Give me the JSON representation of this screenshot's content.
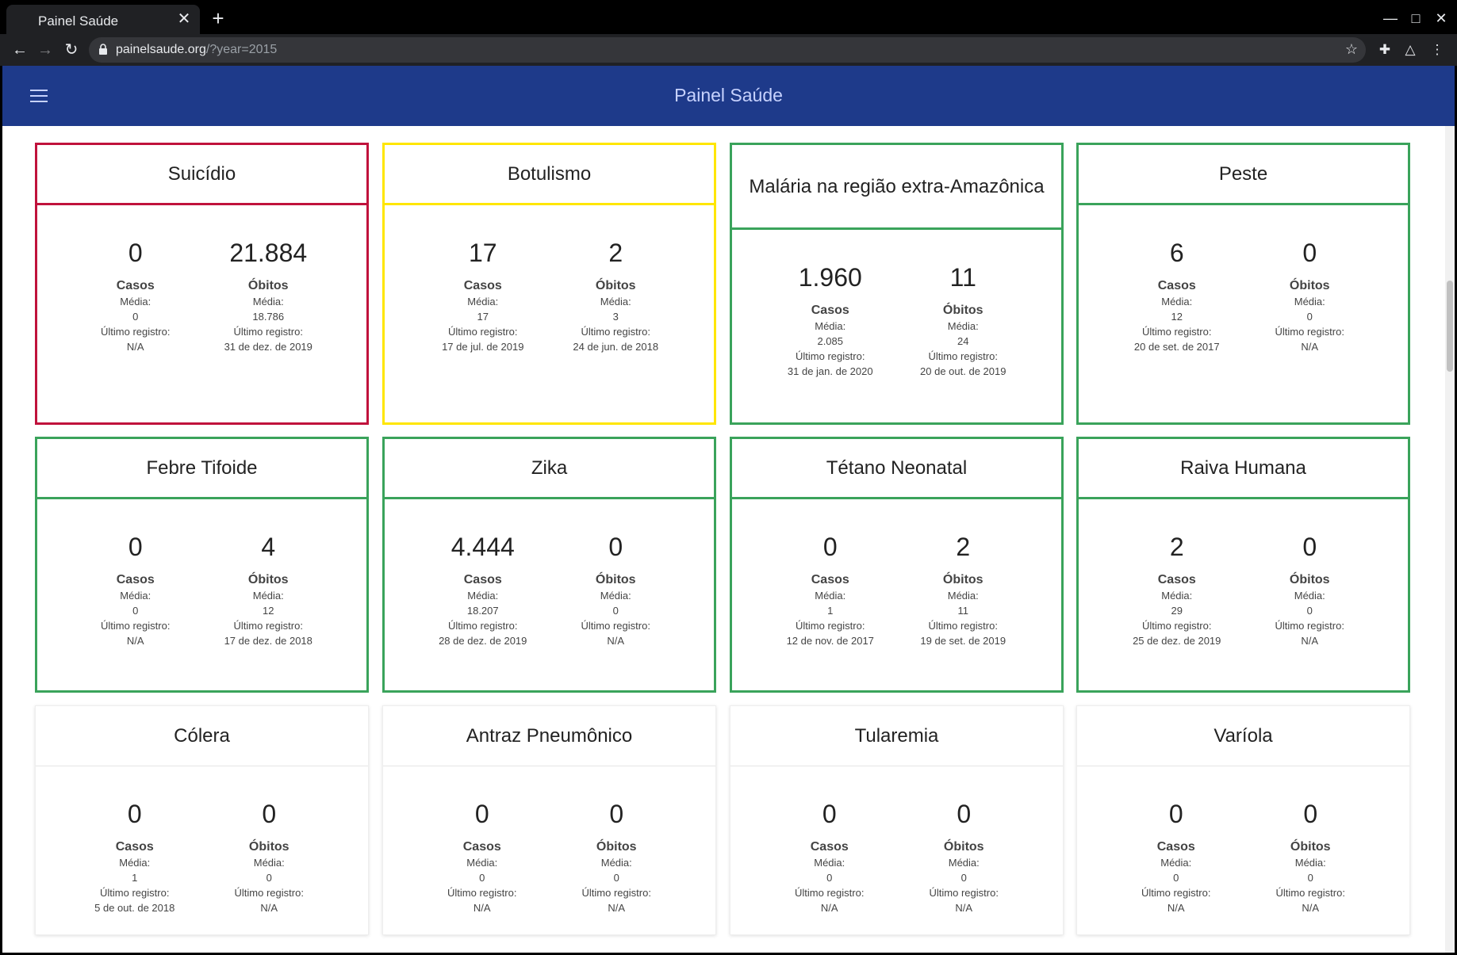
{
  "browser": {
    "tab_title": "Painel Saúde",
    "url_host": "painelsaude.org",
    "url_path": "/?year=2015"
  },
  "app": {
    "title": "Painel Saúde"
  },
  "cards": [
    {
      "title": "Suicídio",
      "status": "red",
      "casos": "0",
      "obitos": "21.884",
      "casos_media": "0",
      "obitos_media": "18.786",
      "casos_ultimo": "N/A",
      "obitos_ultimo": "31 de dez. de 2019"
    },
    {
      "title": "Botulismo",
      "status": "yellow",
      "casos": "17",
      "obitos": "2",
      "casos_media": "17",
      "obitos_media": "3",
      "casos_ultimo": "17 de jul. de 2019",
      "obitos_ultimo": "24 de jun. de 2018"
    },
    {
      "title": "Malária na região extra-Amazônica",
      "status": "green",
      "casos": "1.960",
      "obitos": "11",
      "casos_media": "2.085",
      "obitos_media": "24",
      "casos_ultimo": "31 de jan. de 2020",
      "obitos_ultimo": "20 de out. de 2019"
    },
    {
      "title": "Peste",
      "status": "green",
      "casos": "6",
      "obitos": "0",
      "casos_media": "12",
      "obitos_media": "0",
      "casos_ultimo": "20 de set. de 2017",
      "obitos_ultimo": "N/A"
    },
    {
      "title": "Febre Tifoide",
      "status": "green",
      "casos": "0",
      "obitos": "4",
      "casos_media": "0",
      "obitos_media": "12",
      "casos_ultimo": "N/A",
      "obitos_ultimo": "17 de dez. de 2018"
    },
    {
      "title": "Zika",
      "status": "green",
      "casos": "4.444",
      "obitos": "0",
      "casos_media": "18.207",
      "obitos_media": "0",
      "casos_ultimo": "28 de dez. de 2019",
      "obitos_ultimo": "N/A"
    },
    {
      "title": "Tétano Neonatal",
      "status": "green",
      "casos": "0",
      "obitos": "2",
      "casos_media": "1",
      "obitos_media": "11",
      "casos_ultimo": "12 de nov. de 2017",
      "obitos_ultimo": "19 de set. de 2019"
    },
    {
      "title": "Raiva Humana",
      "status": "green",
      "casos": "2",
      "obitos": "0",
      "casos_media": "29",
      "obitos_media": "0",
      "casos_ultimo": "25 de dez. de 2019",
      "obitos_ultimo": "N/A"
    },
    {
      "title": "Cólera",
      "status": "plain",
      "casos": "0",
      "obitos": "0",
      "casos_media": "1",
      "obitos_media": "0",
      "casos_ultimo": "5 de out. de 2018",
      "obitos_ultimo": "N/A"
    },
    {
      "title": "Antraz Pneumônico",
      "status": "plain",
      "casos": "0",
      "obitos": "0",
      "casos_media": "0",
      "obitos_media": "0",
      "casos_ultimo": "N/A",
      "obitos_ultimo": "N/A"
    },
    {
      "title": "Tularemia",
      "status": "plain",
      "casos": "0",
      "obitos": "0",
      "casos_media": "0",
      "obitos_media": "0",
      "casos_ultimo": "N/A",
      "obitos_ultimo": "N/A"
    },
    {
      "title": "Varíola",
      "status": "plain",
      "casos": "0",
      "obitos": "0",
      "casos_media": "0",
      "obitos_media": "0",
      "casos_ultimo": "N/A",
      "obitos_ultimo": "N/A"
    }
  ],
  "labels": {
    "casos": "Casos",
    "obitos": "Óbitos",
    "media": "Média:",
    "ultimo": "Último registro:"
  },
  "colors": {
    "red": "#c0123c",
    "yellow": "#ffe600",
    "green": "#3aa35b",
    "appbar": "#1e3a8a"
  }
}
